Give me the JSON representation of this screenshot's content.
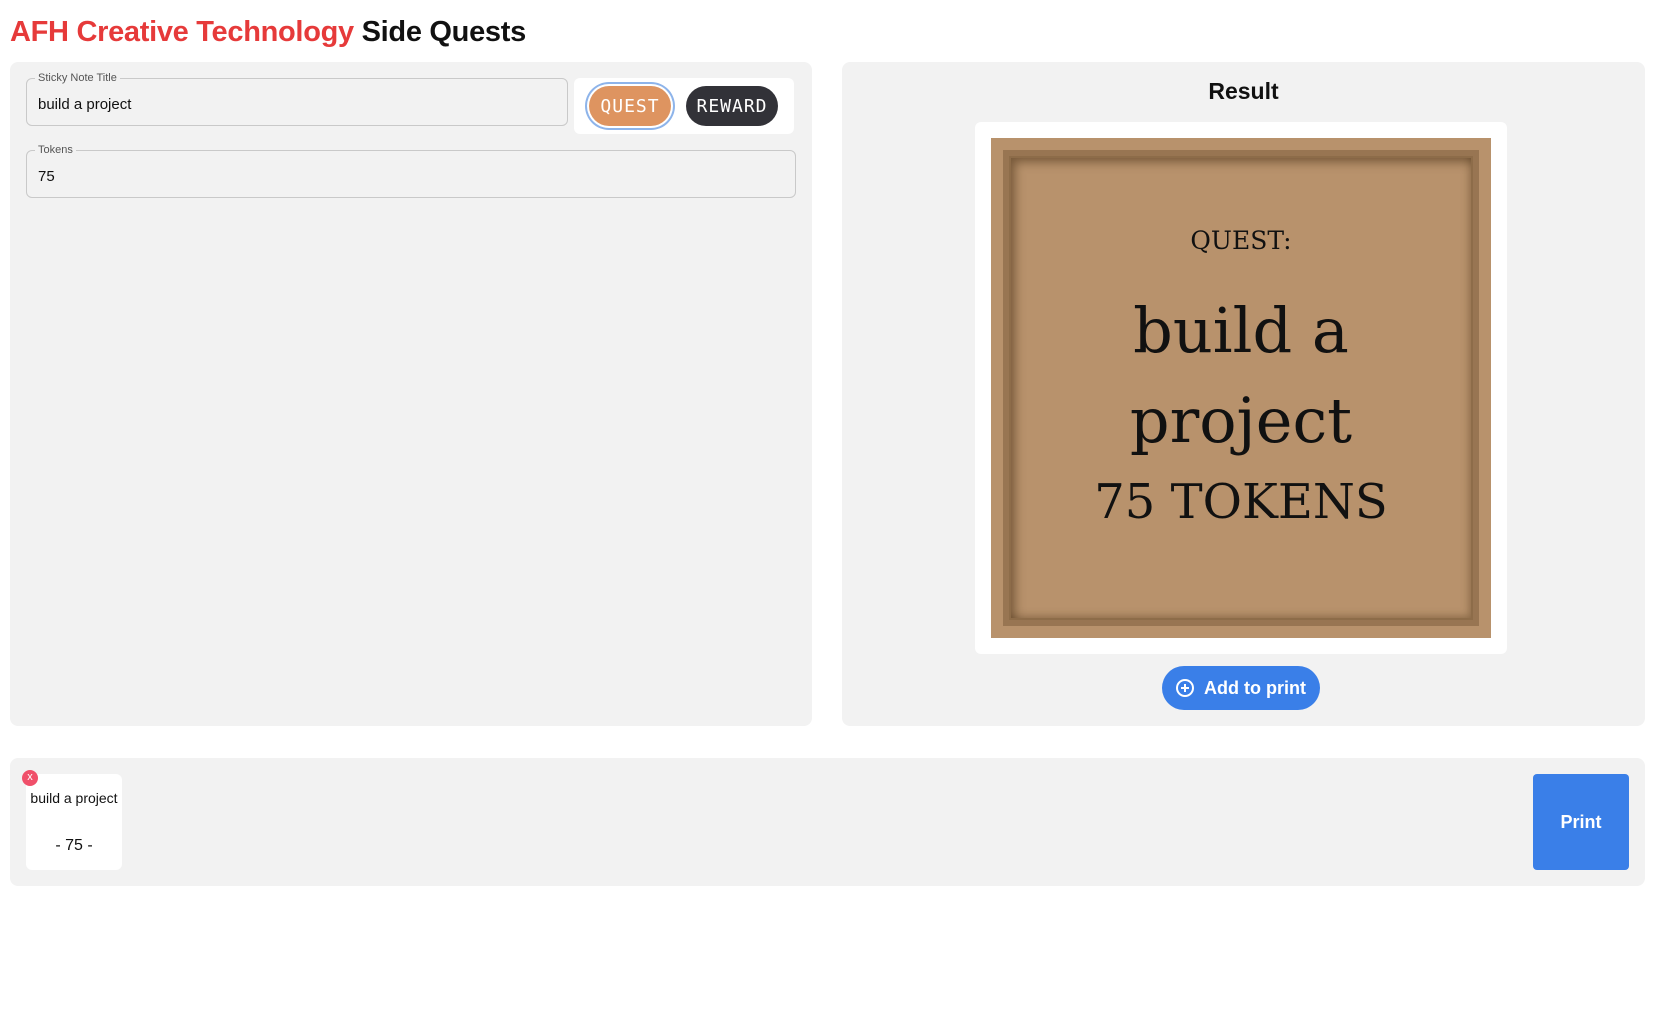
{
  "header": {
    "brand": "AFH Creative Technology",
    "title": "Side Quests"
  },
  "form": {
    "title_field": {
      "label": "Sticky Note Title",
      "value": "build a project"
    },
    "tokens_field": {
      "label": "Tokens",
      "value": "75"
    },
    "toggle": {
      "quest_label": "QUEST",
      "reward_label": "REWARD",
      "selected": "QUEST"
    }
  },
  "result": {
    "heading": "Result",
    "note": {
      "kind": "QUEST:",
      "title": "build a project",
      "tokens": "75 TOKENS",
      "background_color": "#b8926c"
    },
    "add_button": {
      "label": "Add to print",
      "icon": "plus-circle-icon"
    }
  },
  "queue": {
    "items": [
      {
        "title": "build a project",
        "tokens": "- 75 -",
        "remove_label": "x"
      }
    ],
    "print_label": "Print"
  },
  "colors": {
    "brand": "#e63a3a",
    "quest": "#de9460",
    "reward": "#323238",
    "primary": "#3a7fe8",
    "remove": "#f0506a"
  }
}
